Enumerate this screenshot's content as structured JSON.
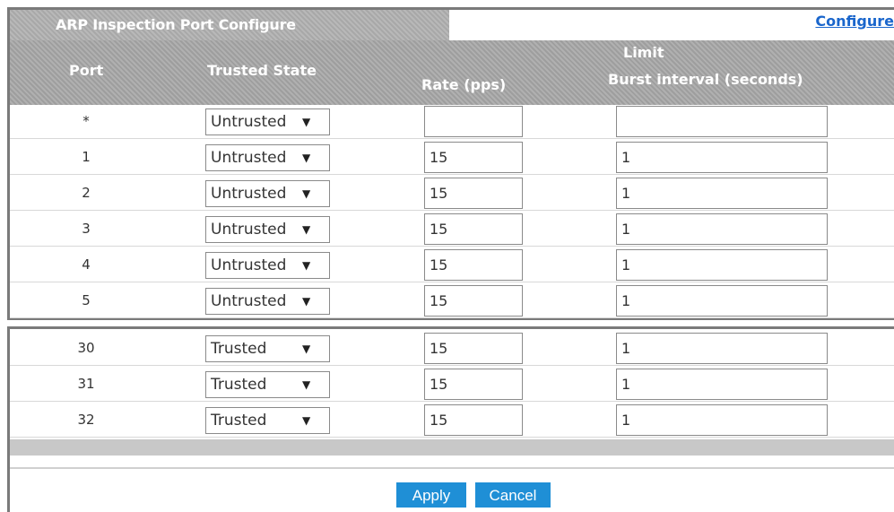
{
  "panel": {
    "title": "ARP Inspection Port Configure",
    "configure_link": "Configure"
  },
  "columns": {
    "port": "Port",
    "trusted_state": "Trusted State",
    "limit": "Limit",
    "rate": "Rate (pps)",
    "burst": "Burst interval (seconds)"
  },
  "rows_top": [
    {
      "port": "*",
      "state": "Untrusted",
      "rate": "",
      "burst": ""
    },
    {
      "port": "1",
      "state": "Untrusted",
      "rate": "15",
      "burst": "1"
    },
    {
      "port": "2",
      "state": "Untrusted",
      "rate": "15",
      "burst": "1"
    },
    {
      "port": "3",
      "state": "Untrusted",
      "rate": "15",
      "burst": "1"
    },
    {
      "port": "4",
      "state": "Untrusted",
      "rate": "15",
      "burst": "1"
    },
    {
      "port": "5",
      "state": "Untrusted",
      "rate": "15",
      "burst": "1"
    }
  ],
  "rows_bottom": [
    {
      "port": "30",
      "state": "Trusted",
      "rate": "15",
      "burst": "1"
    },
    {
      "port": "31",
      "state": "Trusted",
      "rate": "15",
      "burst": "1"
    },
    {
      "port": "32",
      "state": "Trusted",
      "rate": "15",
      "burst": "1"
    }
  ],
  "buttons": {
    "apply": "Apply",
    "cancel": "Cancel"
  },
  "colors": {
    "button_blue": "#1f8fd6",
    "link_blue": "#1a66cc",
    "header_gray": "#a8a8a8"
  },
  "icons": {
    "dropdown": "triangle-down-icon"
  }
}
